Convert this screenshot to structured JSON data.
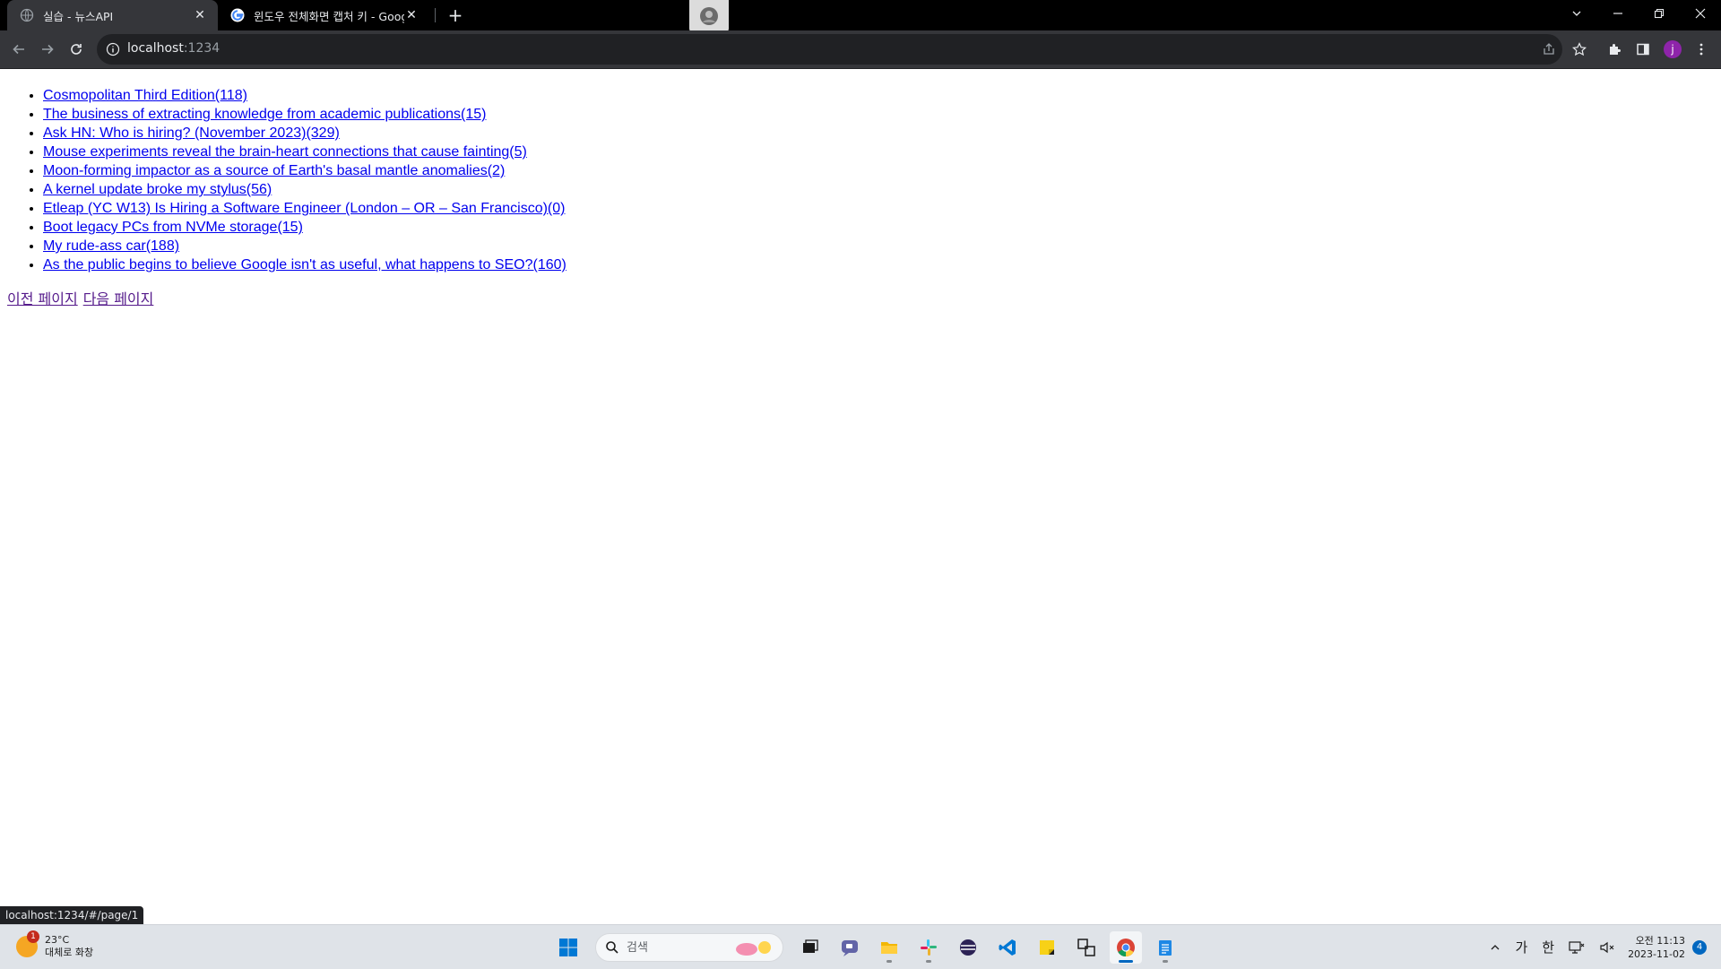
{
  "browser": {
    "tabs": [
      {
        "title": "실습 - 뉴스API",
        "active": true
      },
      {
        "title": "윈도우 전체화면 캡처 키 - Google",
        "active": false
      }
    ],
    "url_host": "localhost",
    "url_port": ":1234",
    "avatar_letter": "j"
  },
  "news": {
    "items": [
      {
        "text": "Cosmopolitan Third Edition(118)"
      },
      {
        "text": "The business of extracting knowledge from academic publications(15)"
      },
      {
        "text": "Ask HN: Who is hiring? (November 2023)(329)"
      },
      {
        "text": "Mouse experiments reveal the brain-heart connections that cause fainting(5)"
      },
      {
        "text": "Moon-forming impactor as a source of Earth's basal mantle anomalies(2)"
      },
      {
        "text": "A kernel update broke my stylus(56)"
      },
      {
        "text": "Etleap (YC W13) Is Hiring a Software Engineer (London – OR – San Francisco)(0)"
      },
      {
        "text": "Boot legacy PCs from NVMe storage(15)"
      },
      {
        "text": "My rude-ass car(188)"
      },
      {
        "text": "As the public begins to believe Google isn't as useful, what happens to SEO?(160)"
      }
    ]
  },
  "pager": {
    "prev_label": "이전 페이지",
    "next_label": "다음 페이지"
  },
  "status_url": "localhost:1234/#/page/1",
  "taskbar": {
    "weather_badge": "1",
    "weather_temp": "23°C",
    "weather_desc": "대체로 화창",
    "search_placeholder": "검색",
    "ime_lang": "가",
    "ime_mode": "한",
    "clock_time": "오전 11:13",
    "clock_date": "2023-11-02",
    "notification_count": "4"
  },
  "colors": {
    "link": "#0000ee",
    "visited_link": "#551a8b",
    "tabstrip": "#000000",
    "toolbar": "#35363a",
    "taskbar": "#dfe3e8",
    "accent": "#0067c0"
  }
}
